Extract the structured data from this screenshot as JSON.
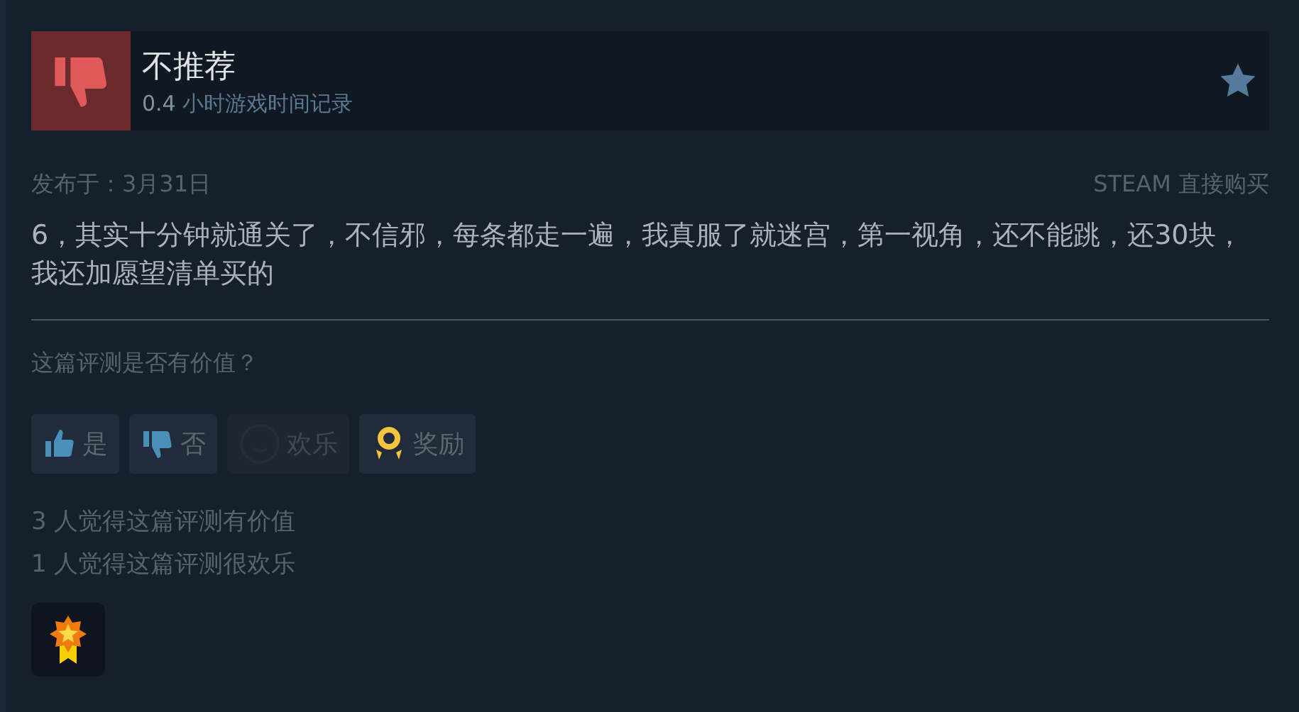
{
  "header": {
    "verdict": "不推荐",
    "recommended": false,
    "hours": "0.4",
    "hours_label": "小时游戏时间记录"
  },
  "posted": "发布于：3月31日",
  "source": "STEAM 直接购买",
  "body": "6，其实十分钟就通关了，不信邪，每条都走一遍，我真服了就迷宫，第一视角，还不能跳，还30块，我还加愿望清单买的",
  "prompt": "这篇评测是否有价值？",
  "buttons": [
    {
      "kind": "up",
      "label": "是",
      "disabled": false
    },
    {
      "kind": "down",
      "label": "否",
      "disabled": false
    },
    {
      "kind": "funny",
      "label": "欢乐",
      "disabled": true
    },
    {
      "kind": "award",
      "label": "奖励",
      "disabled": false
    }
  ],
  "stats": [
    "3 人觉得这篇评测有价值",
    "1 人觉得这篇评测很欢乐"
  ]
}
